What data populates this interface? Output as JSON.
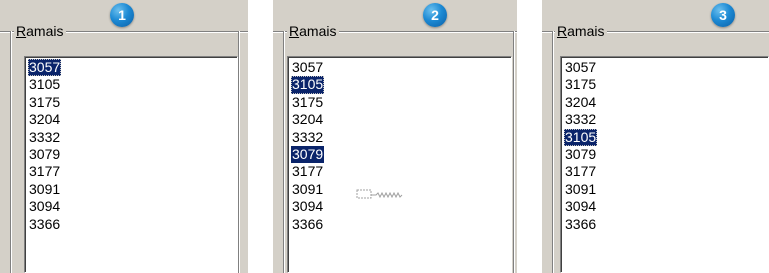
{
  "panels": [
    {
      "step": "1",
      "title_accel": "R",
      "title_rest": "amais",
      "items": [
        "3057",
        "3105",
        "3175",
        "3204",
        "3332",
        "3079",
        "3177",
        "3091",
        "3094",
        "3366"
      ],
      "selected": [
        0
      ],
      "focused": 0
    },
    {
      "step": "2",
      "title_accel": "R",
      "title_rest": "amais",
      "items": [
        "3057",
        "3105",
        "3175",
        "3204",
        "3332",
        "3079",
        "3177",
        "3091",
        "3094",
        "3366"
      ],
      "selected": [
        1,
        5
      ],
      "focused": 1,
      "drag_indicator_icon": "drag-move-icon"
    },
    {
      "step": "3",
      "title_accel": "R",
      "title_rest": "amais",
      "items": [
        "3057",
        "3175",
        "3204",
        "3332",
        "3105",
        "3079",
        "3177",
        "3091",
        "3094",
        "3366"
      ],
      "selected": [
        4
      ],
      "focused": 4
    }
  ],
  "colors": {
    "face": "#d4d0c8",
    "selection": "#0a246a",
    "badge": "#1d8ad4"
  }
}
